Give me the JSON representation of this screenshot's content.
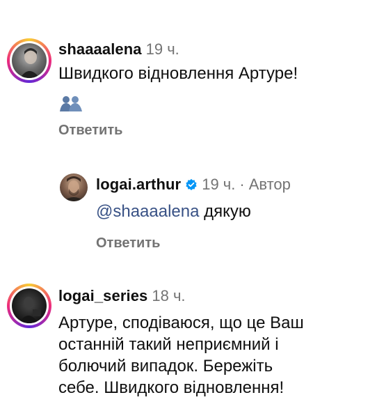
{
  "comments": [
    {
      "username": "shaaaalena",
      "time": "19 ч.",
      "text": "Швидкого відновлення Артуре!",
      "emoji_icon": "hugging-silhouettes-icon",
      "reply_label": "Ответить"
    },
    {
      "username": "logai.arthur",
      "time": "19 ч.",
      "author_label": "Автор",
      "mention": "@shaaaalena",
      "text": " дякую",
      "reply_label": "Ответить"
    },
    {
      "username": "logai_series",
      "time": "18 ч.",
      "text_lines": [
        "Артуре, сподіваюся, що це Ваш",
        "останній такий неприємний і",
        "болючий випадок. Бережіть",
        "себе. Швидкого відновлення!"
      ]
    }
  ],
  "colors": {
    "secondary_text": "#737373",
    "mention": "#385185",
    "verified": "#0095f6"
  }
}
